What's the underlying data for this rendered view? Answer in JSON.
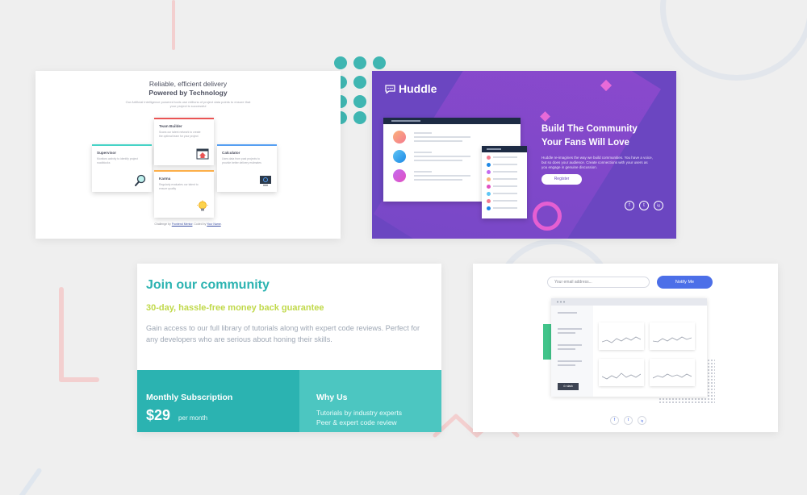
{
  "panel1": {
    "subtitle": "Reliable, efficient delivery",
    "title": "Powered by Technology",
    "description": "Our Artificial Intelligence powered tools use millions of project data points to ensure that your project is successful",
    "cards": [
      {
        "title": "Supervisor",
        "description": "Monitors activity to identify project roadblocks",
        "accent": "#45d3c6",
        "icon": "magnifier-icon"
      },
      {
        "title": "Team Builder",
        "description": "Scans our talent network to create the optimal team for your project",
        "accent": "#ea5454",
        "icon": "team-builder-icon"
      },
      {
        "title": "Karma",
        "description": "Regularly evaluates our talent to ensure quality",
        "accent": "#fcaf4a",
        "icon": "lightbulb-icon"
      },
      {
        "title": "Calculator",
        "description": "Uses data from past projects to provide better delivery estimates",
        "accent": "#549ef2",
        "icon": "monitor-icon"
      }
    ],
    "attribution_prefix": "Challenge by ",
    "attribution_link1": "Frontend Mentor",
    "attribution_mid": ". Coded by ",
    "attribution_link2": "Your Name",
    "attribution_suffix": "."
  },
  "panel2": {
    "logo": "Huddle",
    "headline_line1": "Build The Community",
    "headline_line2": "Your Fans Will Love",
    "description": "Huddle re-imagines the way we build communities. You have a voice, but so does your audience. Create connections with your users as you engage in genuine discussion.",
    "button": "Register",
    "social": [
      "f",
      "t",
      "ig"
    ]
  },
  "panel3": {
    "title": "Join our community",
    "subtitle": "30-day, hassle-free money back guarantee",
    "description": "Gain access to our full library of tutorials along with expert code reviews. Perfect for any developers who are serious about honing their skills.",
    "monthly_title": "Monthly Subscription",
    "price": "$29",
    "per": "per month",
    "why_title": "Why Us",
    "why_items": [
      "Tutorials by industry experts",
      "Peer & expert code review"
    ]
  },
  "panel4": {
    "email_placeholder": "Your email address...",
    "notify_button": "Notify Me",
    "sidebar_button": "⊙ slack",
    "social": [
      "f",
      "t",
      "ig"
    ]
  }
}
